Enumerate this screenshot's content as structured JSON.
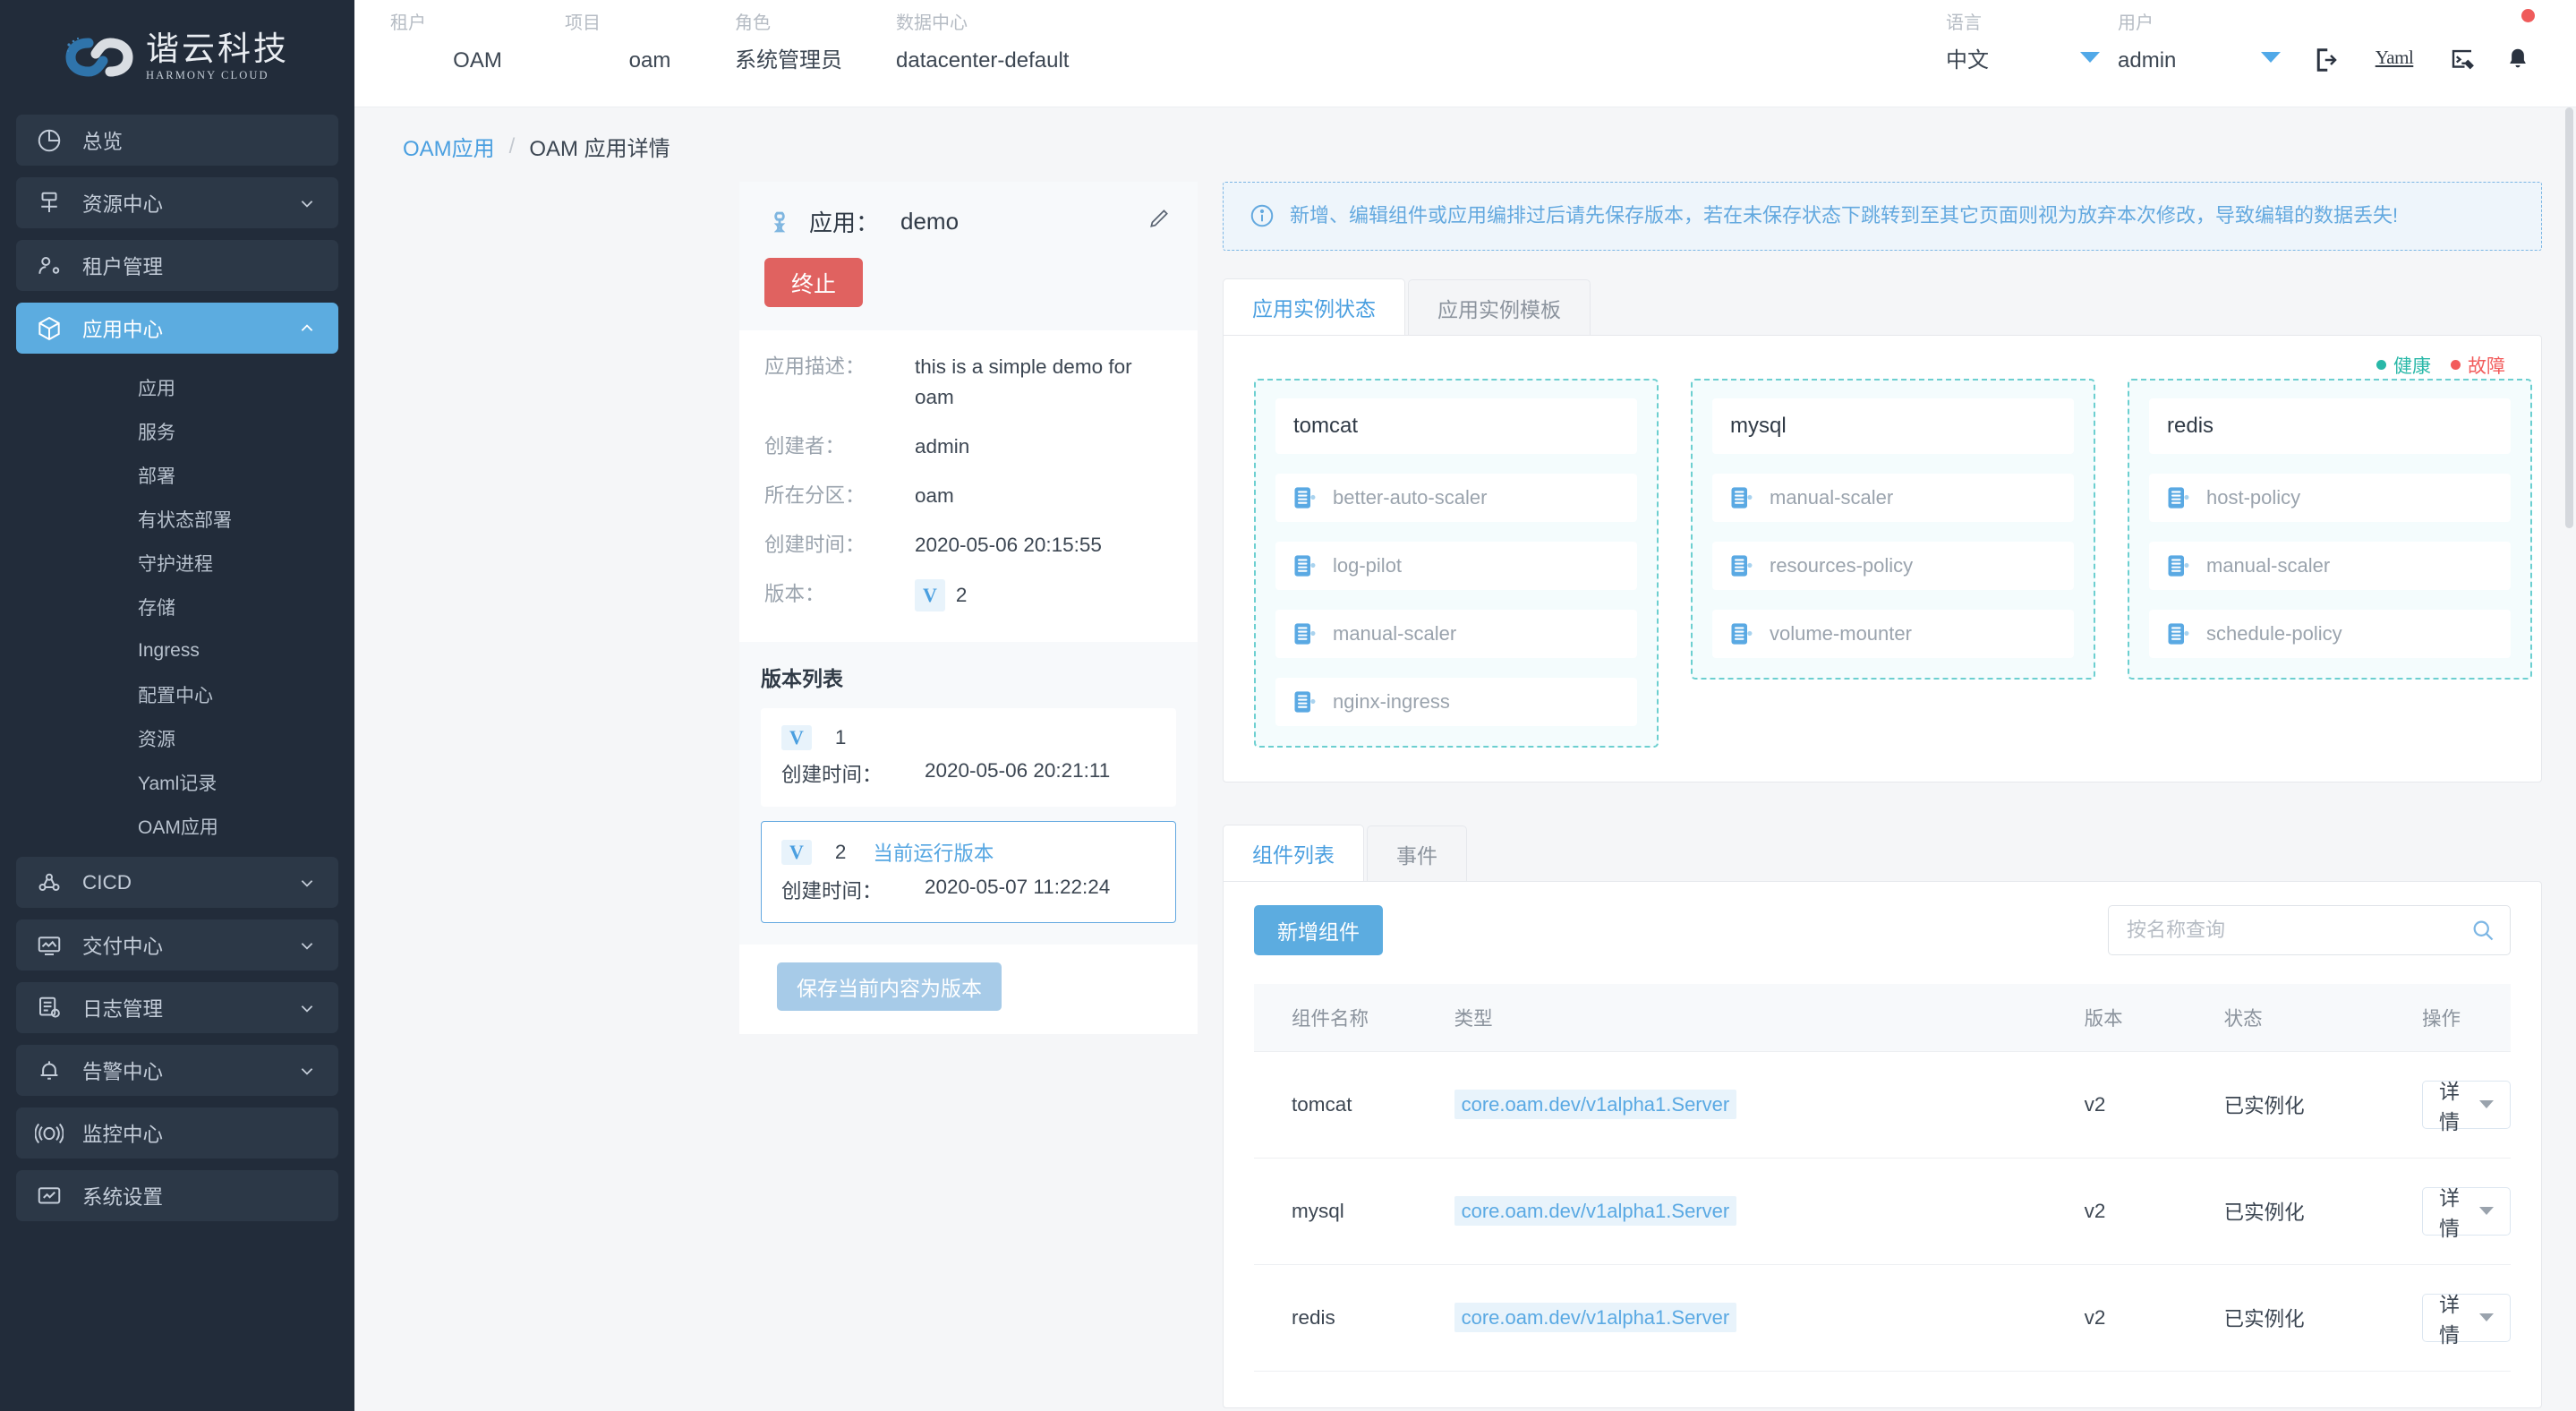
{
  "brand": {
    "name_cn": "谐云科技",
    "name_en": "HARMONY CLOUD",
    "logo_icon": "infinity-logo-icon"
  },
  "sidebar": {
    "items": [
      {
        "label": "总览",
        "icon": "pie-chart-icon",
        "expandable": false,
        "active": false
      },
      {
        "label": "资源中心",
        "icon": "resource-icon",
        "expandable": true,
        "active": false
      },
      {
        "label": "租户管理",
        "icon": "tenant-icon",
        "expandable": false,
        "active": false
      },
      {
        "label": "应用中心",
        "icon": "cube-icon",
        "expandable": true,
        "active": true
      }
    ],
    "sub_items": [
      {
        "label": "应用"
      },
      {
        "label": "服务"
      },
      {
        "label": "部署"
      },
      {
        "label": "有状态部署"
      },
      {
        "label": "守护进程"
      },
      {
        "label": "存储"
      },
      {
        "label": "Ingress"
      },
      {
        "label": "配置中心"
      },
      {
        "label": "资源"
      },
      {
        "label": "Yaml记录"
      },
      {
        "label": "OAM应用"
      }
    ],
    "items_bottom": [
      {
        "label": "CICD",
        "icon": "cicd-icon",
        "expandable": true
      },
      {
        "label": "交付中心",
        "icon": "delivery-icon",
        "expandable": true
      },
      {
        "label": "日志管理",
        "icon": "log-icon",
        "expandable": true
      },
      {
        "label": "告警中心",
        "icon": "alarm-bell-icon",
        "expandable": true
      },
      {
        "label": "监控中心",
        "icon": "monitor-signal-icon",
        "expandable": false
      },
      {
        "label": "系统设置",
        "icon": "system-settings-icon",
        "expandable": false
      }
    ]
  },
  "topbar": {
    "fields": [
      {
        "label": "租户",
        "value": "OAM"
      },
      {
        "label": "项目",
        "value": "oam"
      },
      {
        "label": "角色",
        "value": "系统管理员"
      },
      {
        "label": "数据中心",
        "value": "datacenter-default"
      }
    ],
    "language_label": "语言",
    "language_value": "中文",
    "user_label": "用户",
    "user_value": "admin",
    "yaml_link": "Yaml",
    "icons": [
      "logout-icon",
      "terminal-icon",
      "notification-bell-icon"
    ]
  },
  "breadcrumb": {
    "root": "OAM应用",
    "separator": "/",
    "current": "OAM 应用详情"
  },
  "app_panel": {
    "icon": "link-chain-icon",
    "title_label": "应用：",
    "title_value": "demo",
    "edit_icon": "pencil-edit-icon",
    "stop_button": "终止",
    "info": [
      {
        "key": "应用描述：",
        "value": "this is a simple demo for oam"
      },
      {
        "key": "创建者：",
        "value": "admin"
      },
      {
        "key": "所在分区：",
        "value": "oam"
      },
      {
        "key": "创建时间：",
        "value": "2020-05-06 20:15:55"
      }
    ],
    "version_key": "版本：",
    "version_badge": "V",
    "version_value": "2"
  },
  "version_list": {
    "title": "版本列表",
    "time_key": "创建时间：",
    "badge": "V",
    "running_tag": "当前运行版本",
    "items": [
      {
        "number": "1",
        "created": "2020-05-06 20:21:11",
        "running": false,
        "selected": false
      },
      {
        "number": "2",
        "created": "2020-05-07 11:22:24",
        "running": true,
        "selected": true
      }
    ],
    "save_button": "保存当前内容为版本"
  },
  "alert": {
    "icon": "info-circle-icon",
    "text": "新增、编辑组件或应用编排过后请先保存版本，若在未保存状态下跳转到至其它页面则视为放弃本次修改，导致编辑的数据丢失!"
  },
  "status_tabs": [
    {
      "label": "应用实例状态",
      "active": true
    },
    {
      "label": "应用实例模板",
      "active": false
    }
  ],
  "legend": [
    {
      "label": "健康",
      "color": "#29b8a8"
    },
    {
      "label": "故障",
      "color": "#f25b5b"
    }
  ],
  "component_cards": [
    {
      "name": "tomcat",
      "traits": [
        "better-auto-scaler",
        "log-pilot",
        "manual-scaler",
        "nginx-ingress"
      ]
    },
    {
      "name": "mysql",
      "traits": [
        "manual-scaler",
        "resources-policy",
        "volume-mounter"
      ]
    },
    {
      "name": "redis",
      "traits": [
        "host-policy",
        "manual-scaler",
        "schedule-policy"
      ]
    }
  ],
  "trait_icon": "server-stack-icon",
  "bottom_tabs": [
    {
      "label": "组件列表",
      "active": true
    },
    {
      "label": "事件",
      "active": false
    }
  ],
  "table_toolbar": {
    "add_button": "新增组件",
    "search_placeholder": "按名称查询",
    "search_value": "",
    "search_icon": "search-icon"
  },
  "table": {
    "headers": [
      "组件名称",
      "类型",
      "版本",
      "状态",
      "操作"
    ],
    "rows": [
      {
        "name": "tomcat",
        "type": "core.oam.dev/v1alpha1.Server",
        "version": "v2",
        "status": "已实例化",
        "action": "详情"
      },
      {
        "name": "mysql",
        "type": "core.oam.dev/v1alpha1.Server",
        "version": "v2",
        "status": "已实例化",
        "action": "详情"
      },
      {
        "name": "redis",
        "type": "core.oam.dev/v1alpha1.Server",
        "version": "v2",
        "status": "已实例化",
        "action": "详情"
      }
    ]
  },
  "colors": {
    "accent": "#5cace0",
    "danger": "#e06260",
    "healthy": "#29b8a8",
    "failed": "#f25b5b",
    "sidebar_bg": "#222c3a"
  }
}
